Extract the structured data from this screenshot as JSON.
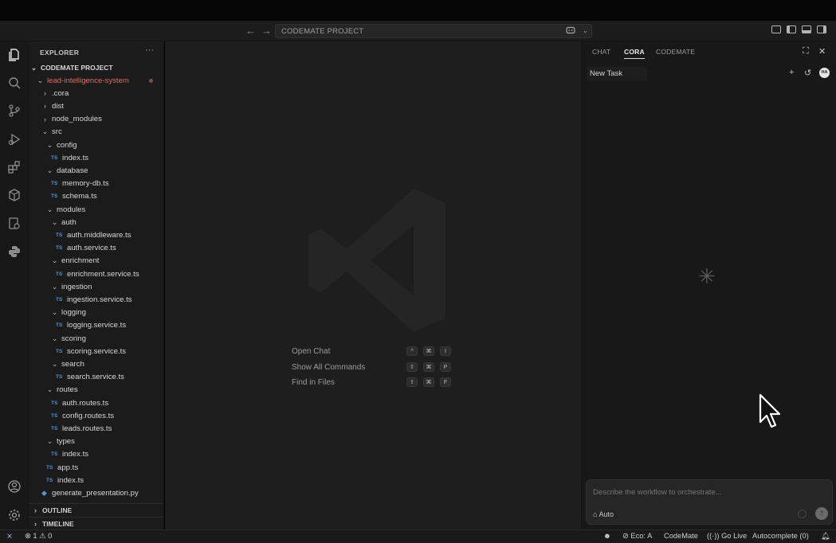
{
  "titlebar": {
    "back_icon": "arrow-left-icon",
    "forward_icon": "arrow-right-icon",
    "command_center_text": "CODEMATE PROJECT",
    "copilot_icon": "copilot-icon",
    "layout_icons": [
      "customize-layout-icon",
      "toggle-primary-sidebar-icon",
      "toggle-panel-icon",
      "toggle-secondary-sidebar-icon"
    ]
  },
  "activity_bar": {
    "items": [
      "explorer-icon",
      "search-icon",
      "source-control-icon",
      "run-debug-icon",
      "extensions-icon",
      "remote-explorer-icon",
      "test-icon",
      "python-icon"
    ],
    "bottom": [
      "account-icon",
      "settings-gear-icon"
    ]
  },
  "explorer": {
    "title": "EXPLORER",
    "more": "···",
    "root": "CODEMATE PROJECT",
    "ts_badge": "TS",
    "tree": [
      {
        "label": "lead-intelligence-system",
        "indent": 0,
        "type": "folder-open",
        "modified": true
      },
      {
        "label": ".cora",
        "indent": 1,
        "type": "folder"
      },
      {
        "label": "dist",
        "indent": 1,
        "type": "folder"
      },
      {
        "label": "node_modules",
        "indent": 1,
        "type": "folder"
      },
      {
        "label": "src",
        "indent": 1,
        "type": "folder-open"
      },
      {
        "label": "config",
        "indent": 2,
        "type": "folder-open"
      },
      {
        "label": "index.ts",
        "indent": 3,
        "type": "ts"
      },
      {
        "label": "database",
        "indent": 2,
        "type": "folder-open"
      },
      {
        "label": "memory-db.ts",
        "indent": 3,
        "type": "ts"
      },
      {
        "label": "schema.ts",
        "indent": 3,
        "type": "ts"
      },
      {
        "label": "modules",
        "indent": 2,
        "type": "folder-open"
      },
      {
        "label": "auth",
        "indent": 3,
        "type": "folder-open"
      },
      {
        "label": "auth.middleware.ts",
        "indent": 4,
        "type": "ts"
      },
      {
        "label": "auth.service.ts",
        "indent": 4,
        "type": "ts"
      },
      {
        "label": "enrichment",
        "indent": 3,
        "type": "folder-open"
      },
      {
        "label": "enrichment.service.ts",
        "indent": 4,
        "type": "ts"
      },
      {
        "label": "ingestion",
        "indent": 3,
        "type": "folder-open"
      },
      {
        "label": "ingestion.service.ts",
        "indent": 4,
        "type": "ts"
      },
      {
        "label": "logging",
        "indent": 3,
        "type": "folder-open"
      },
      {
        "label": "logging.service.ts",
        "indent": 4,
        "type": "ts"
      },
      {
        "label": "scoring",
        "indent": 3,
        "type": "folder-open"
      },
      {
        "label": "scoring.service.ts",
        "indent": 4,
        "type": "ts"
      },
      {
        "label": "search",
        "indent": 3,
        "type": "folder-open"
      },
      {
        "label": "search.service.ts",
        "indent": 4,
        "type": "ts"
      },
      {
        "label": "routes",
        "indent": 2,
        "type": "folder-open"
      },
      {
        "label": "auth.routes.ts",
        "indent": 3,
        "type": "ts"
      },
      {
        "label": "config.routes.ts",
        "indent": 3,
        "type": "ts"
      },
      {
        "label": "leads.routes.ts",
        "indent": 3,
        "type": "ts"
      },
      {
        "label": "types",
        "indent": 2,
        "type": "folder-open"
      },
      {
        "label": "index.ts",
        "indent": 3,
        "type": "ts"
      },
      {
        "label": "app.ts",
        "indent": 2,
        "type": "ts"
      },
      {
        "label": "index.ts",
        "indent": 2,
        "type": "ts"
      },
      {
        "label": "generate_presentation.py",
        "indent": 1,
        "type": "py"
      }
    ],
    "outline": "OUTLINE",
    "timeline": "TIMELINE"
  },
  "editor": {
    "shortcuts": [
      {
        "label": "Open Chat",
        "keys": [
          "^",
          "⌘",
          "I"
        ]
      },
      {
        "label": "Show All Commands",
        "keys": [
          "⇧",
          "⌘",
          "P"
        ]
      },
      {
        "label": "Find in Files",
        "keys": [
          "⇧",
          "⌘",
          "F"
        ]
      }
    ]
  },
  "aux_panel": {
    "tabs": [
      "CHAT",
      "CORA",
      "CODEMATE"
    ],
    "active_tab": "CORA",
    "new_task": "New Task",
    "avatar_text": "HA",
    "spinner_icon": "✳",
    "input_placeholder": "Describe the workflow to orchestrate...",
    "mode": "Auto"
  },
  "statusbar": {
    "errors": "1",
    "warnings": "0",
    "eco": "Eco: A",
    "codemate": "CodeMate",
    "golive": "Go Live",
    "autocomplete": "Autocomplete (0)"
  }
}
